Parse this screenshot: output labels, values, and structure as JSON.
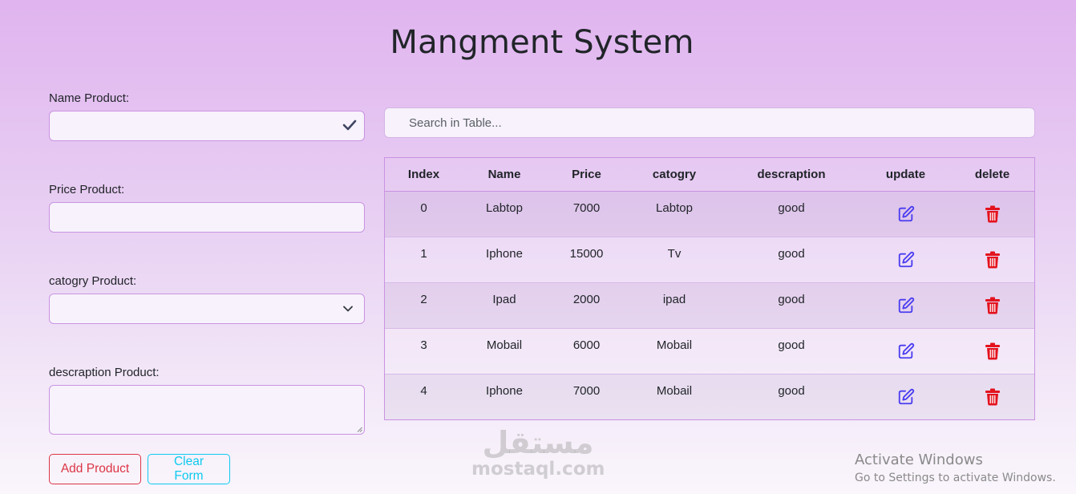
{
  "page": {
    "title": "Mangment System"
  },
  "form": {
    "name_label": "Name Product:",
    "name_value": "",
    "price_label": "Price Product:",
    "price_value": "",
    "category_label": "catogry Product:",
    "category_value": "",
    "description_label": "descraption Product:",
    "description_value": "",
    "add_button": "Add Product",
    "clear_button": "Clear Form"
  },
  "search": {
    "placeholder": "Search in Table...",
    "value": ""
  },
  "table": {
    "headers": [
      "Index",
      "Name",
      "Price",
      "catogry",
      "descraption",
      "update",
      "delete"
    ],
    "rows": [
      {
        "index": "0",
        "name": "Labtop",
        "price": "7000",
        "category": "Labtop",
        "description": "good"
      },
      {
        "index": "1",
        "name": "Iphone",
        "price": "15000",
        "category": "Tv",
        "description": "good"
      },
      {
        "index": "2",
        "name": "Ipad",
        "price": "2000",
        "category": "ipad",
        "description": "good"
      },
      {
        "index": "3",
        "name": "Mobail",
        "price": "6000",
        "category": "Mobail",
        "description": "good"
      },
      {
        "index": "4",
        "name": "Iphone",
        "price": "7000",
        "category": "Mobail",
        "description": "good"
      }
    ]
  },
  "icons": {
    "update": "edit-icon",
    "delete": "trash-icon",
    "valid": "check-icon",
    "select": "chevron-down-icon"
  },
  "colors": {
    "update_icon": "#4a3df0",
    "delete_icon": "#e3121d",
    "add_button": "#dc3545",
    "clear_button": "#0dcaf0"
  },
  "watermark": {
    "logo": "مستقل",
    "text": "mostaql.com"
  },
  "os_notice": {
    "title": "Activate Windows",
    "subtitle": "Go to Settings to activate Windows."
  }
}
